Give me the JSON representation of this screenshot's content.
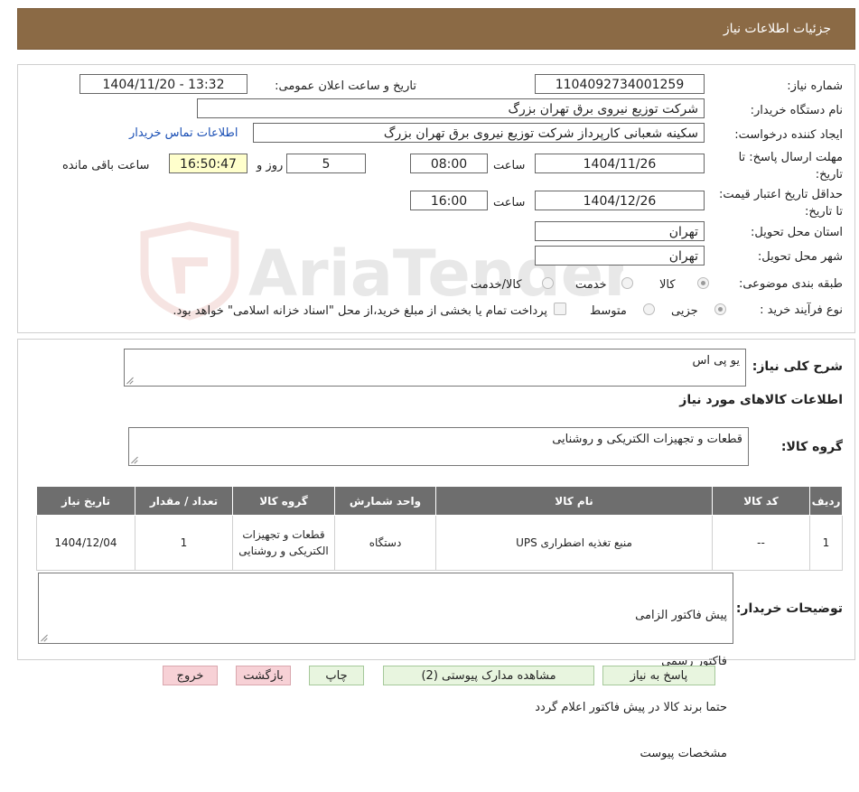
{
  "header": {
    "title": "جزئیات اطلاعات نیاز"
  },
  "watermark": {
    "text": "AriaTender.neT"
  },
  "form": {
    "need_number_label": "شماره نیاز:",
    "need_number": "1104092734001259",
    "announce_label": "تاریخ و ساعت اعلان عمومی:",
    "announce_value": "1404/11/20 - 13:32",
    "buyer_org_label": "نام دستگاه خریدار:",
    "buyer_org": "شرکت توزیع نیروی برق تهران بزرگ",
    "creator_label": "ایجاد کننده درخواست:",
    "creator": "سکینه شعبانی کارپرداز شرکت توزیع نیروی برق تهران بزرگ",
    "contact_link": "اطلاعات تماس خریدار",
    "deadline_label": "مهلت ارسال پاسخ: تا تاریخ:",
    "deadline_date": "1404/11/26",
    "time_label": "ساعت",
    "deadline_time": "08:00",
    "days_value": "5",
    "days_label": "روز و",
    "remaining_time": "16:50:47",
    "remaining_label": "ساعت باقی مانده",
    "validity_label": "حداقل تاریخ اعتبار قیمت: تا تاریخ:",
    "validity_date": "1404/12/26",
    "validity_time_label": "ساعت",
    "validity_time": "16:00",
    "province_label": "استان محل تحویل:",
    "province": "تهران",
    "city_label": "شهر محل تحویل:",
    "city": "تهران",
    "category_label": "طبقه بندی موضوعی:",
    "category_options": [
      "کالا",
      "خدمت",
      "کالا/خدمت"
    ],
    "process_label": "نوع فرآیند خرید :",
    "process_options": [
      "جزیی",
      "متوسط"
    ],
    "payment_note": "پرداخت تمام یا بخشی از مبلغ خرید،از محل \"اسناد خزانه اسلامی\" خواهد بود."
  },
  "summary": {
    "label": "شرح کلی نیاز:",
    "value": "یو پی اس",
    "goods_info_title": "اطلاعات کالاهای مورد نیاز",
    "group_label": "گروه کالا:",
    "group_value": "قطعات و تجهیزات الکتریکی و روشنایی"
  },
  "table": {
    "headers": [
      "ردیف",
      "کد کالا",
      "نام کالا",
      "واحد شمارش",
      "گروه کالا",
      "تعداد / مقدار",
      "تاریخ نیاز"
    ],
    "rows": [
      [
        "1",
        "--",
        "منبع تغذیه اضطراری UPS",
        "دستگاه",
        "قطعات و تجهیزات الکتریکی و روشنایی",
        "1",
        "1404/12/04"
      ]
    ]
  },
  "buyer_notes": {
    "label": "توضیحات خریدار:",
    "lines": [
      "پیش فاکتور الزامی",
      "فاکتور رسمی",
      "حتما برند کالا در پیش فاکتور اعلام گردد",
      "مشخصات پیوست"
    ]
  },
  "buttons": {
    "reply": "پاسخ به نیاز",
    "attachments": "مشاهده مدارک پیوستی (2)",
    "print": "چاپ",
    "back": "بازگشت",
    "exit": "خروج"
  }
}
